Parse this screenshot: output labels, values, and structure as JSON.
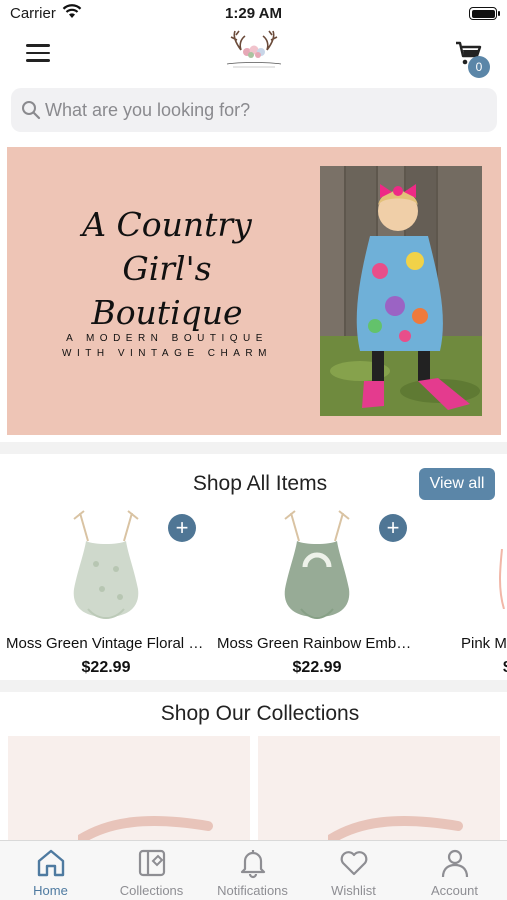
{
  "status_bar": {
    "carrier": "Carrier",
    "time": "1:29 AM"
  },
  "header": {
    "cart_count": "0",
    "logo_text": "A Country Girl's Boutique"
  },
  "search": {
    "placeholder": "What are you looking for?"
  },
  "banner": {
    "line1": "A Country Girl's",
    "line2": "Boutique",
    "tagline1": "A MODERN BOUTIQUE",
    "tagline2": "WITH VINTAGE CHARM"
  },
  "shop_all": {
    "title": "Shop All Items",
    "view_all_label": "View all",
    "products": [
      {
        "name": "Moss Green Vintage Floral Romper",
        "price": "$22.99"
      },
      {
        "name": "Moss Green Rainbow Embe…",
        "price": "$22.99"
      },
      {
        "name": "Pink M",
        "price": "$"
      }
    ]
  },
  "collections": {
    "title": "Shop Our Collections"
  },
  "tabbar": {
    "tabs": [
      {
        "label": "Home",
        "icon": "home-icon"
      },
      {
        "label": "Collections",
        "icon": "collections-icon"
      },
      {
        "label": "Notifications",
        "icon": "bell-icon"
      },
      {
        "label": "Wishlist",
        "icon": "heart-icon"
      },
      {
        "label": "Account",
        "icon": "person-icon"
      }
    ]
  },
  "colors": {
    "accent": "#5b86a8",
    "banner_bg": "#eec5b6"
  }
}
